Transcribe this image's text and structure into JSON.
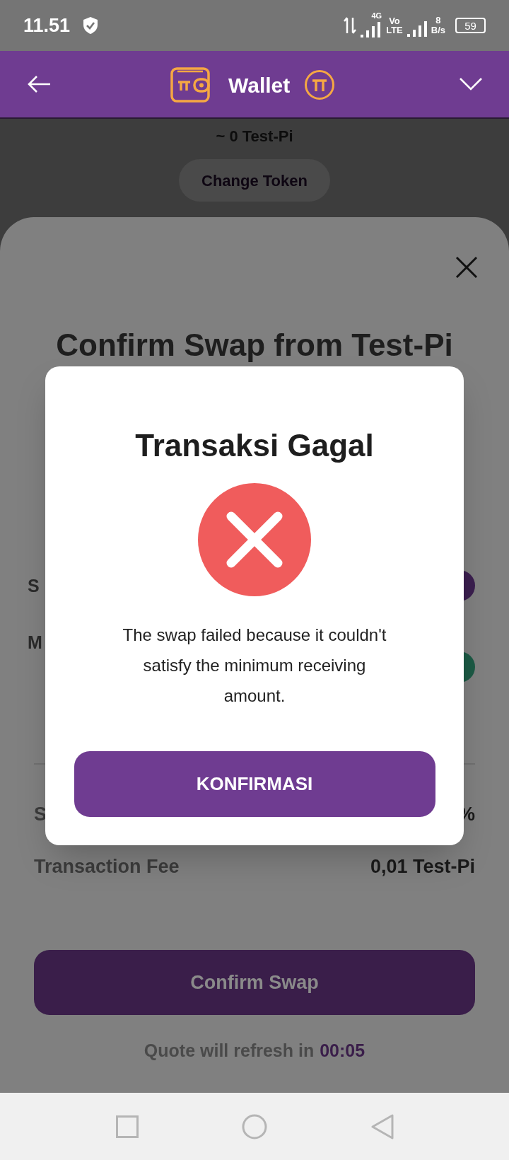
{
  "status_bar": {
    "time": "11.51",
    "network_type": "4G",
    "volte_top": "Vo",
    "volte_bottom": "LTE",
    "speed_value": "8",
    "speed_unit": "B/s",
    "battery": "59"
  },
  "header": {
    "title": "Wallet"
  },
  "background": {
    "balance": "~ 0 Test-Pi",
    "change_token_button": "Change Token"
  },
  "sheet": {
    "title": "Confirm Swap from Test-Pi",
    "rows": [
      {
        "kind": "token",
        "label": "S",
        "color": "#3b1f4f"
      },
      {
        "kind": "token",
        "label": "M",
        "color": "#1c5a45"
      },
      {
        "kind": "divider"
      },
      {
        "kind": "value",
        "label": "S",
        "value": "%"
      },
      {
        "kind": "value",
        "label": "Transaction Fee",
        "value": "0,01 Test-Pi"
      }
    ],
    "confirm_button": "Confirm Swap",
    "refresh_text": "Quote will refresh in",
    "refresh_timer": "00:05"
  },
  "dialog": {
    "title": "Transaksi Gagal",
    "message": "The swap failed because it couldn't satisfy the minimum receiving amount.",
    "button": "KONFIRMASI"
  }
}
